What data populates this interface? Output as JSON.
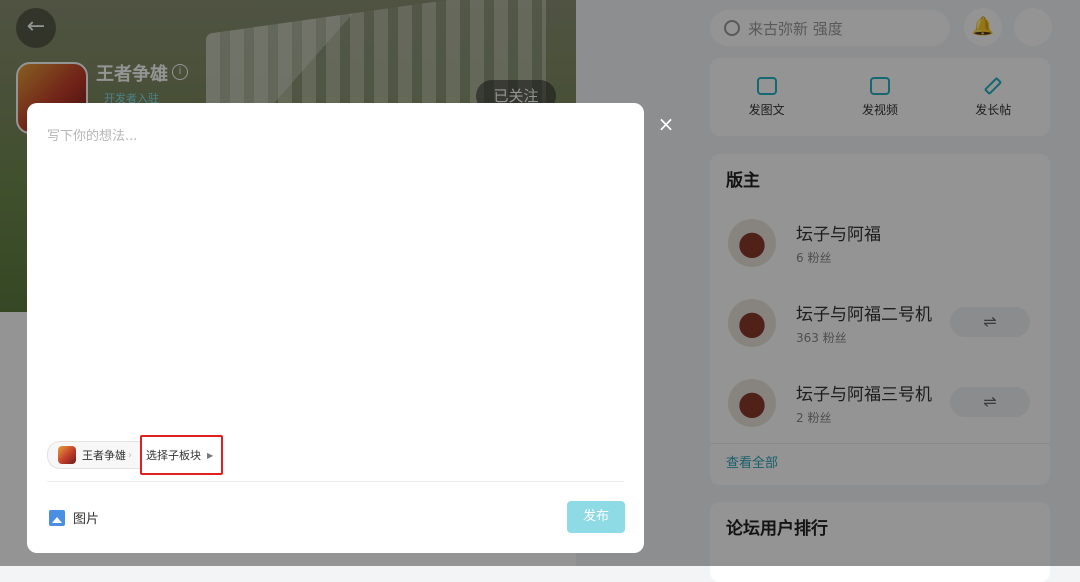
{
  "page": {
    "game_name": "王者争雄",
    "dev_badge": "开发者入驻",
    "follow_label": "已关注",
    "back_icon": "arrow-left-icon"
  },
  "topbar": {
    "search_placeholder": "来古弥新 强度",
    "bell_icon": "bell-icon"
  },
  "post_types": [
    {
      "label": "发图文",
      "icon": "image-text-icon"
    },
    {
      "label": "发视频",
      "icon": "video-icon"
    },
    {
      "label": "发长帖",
      "icon": "pen-icon"
    }
  ],
  "moderators": {
    "title": "版主",
    "items": [
      {
        "name": "坛子与阿福",
        "fans": "6 粉丝"
      },
      {
        "name": "坛子与阿福二号机",
        "fans": "363 粉丝"
      },
      {
        "name": "坛子与阿福三号机",
        "fans": "2 粉丝"
      }
    ],
    "swap_icon": "⇌",
    "see_all": "查看全部"
  },
  "ranking": {
    "title": "论坛用户排行"
  },
  "modal": {
    "placeholder": "写下你的想法...",
    "forum_chip": "王者争雄",
    "subforum_label": "选择子板块",
    "image_label": "图片",
    "publish_label": "发布",
    "close_icon": "×"
  },
  "colors": {
    "accent": "#21b3c4",
    "publish_disabled": "#8edbe6",
    "highlight": "#e02020"
  }
}
